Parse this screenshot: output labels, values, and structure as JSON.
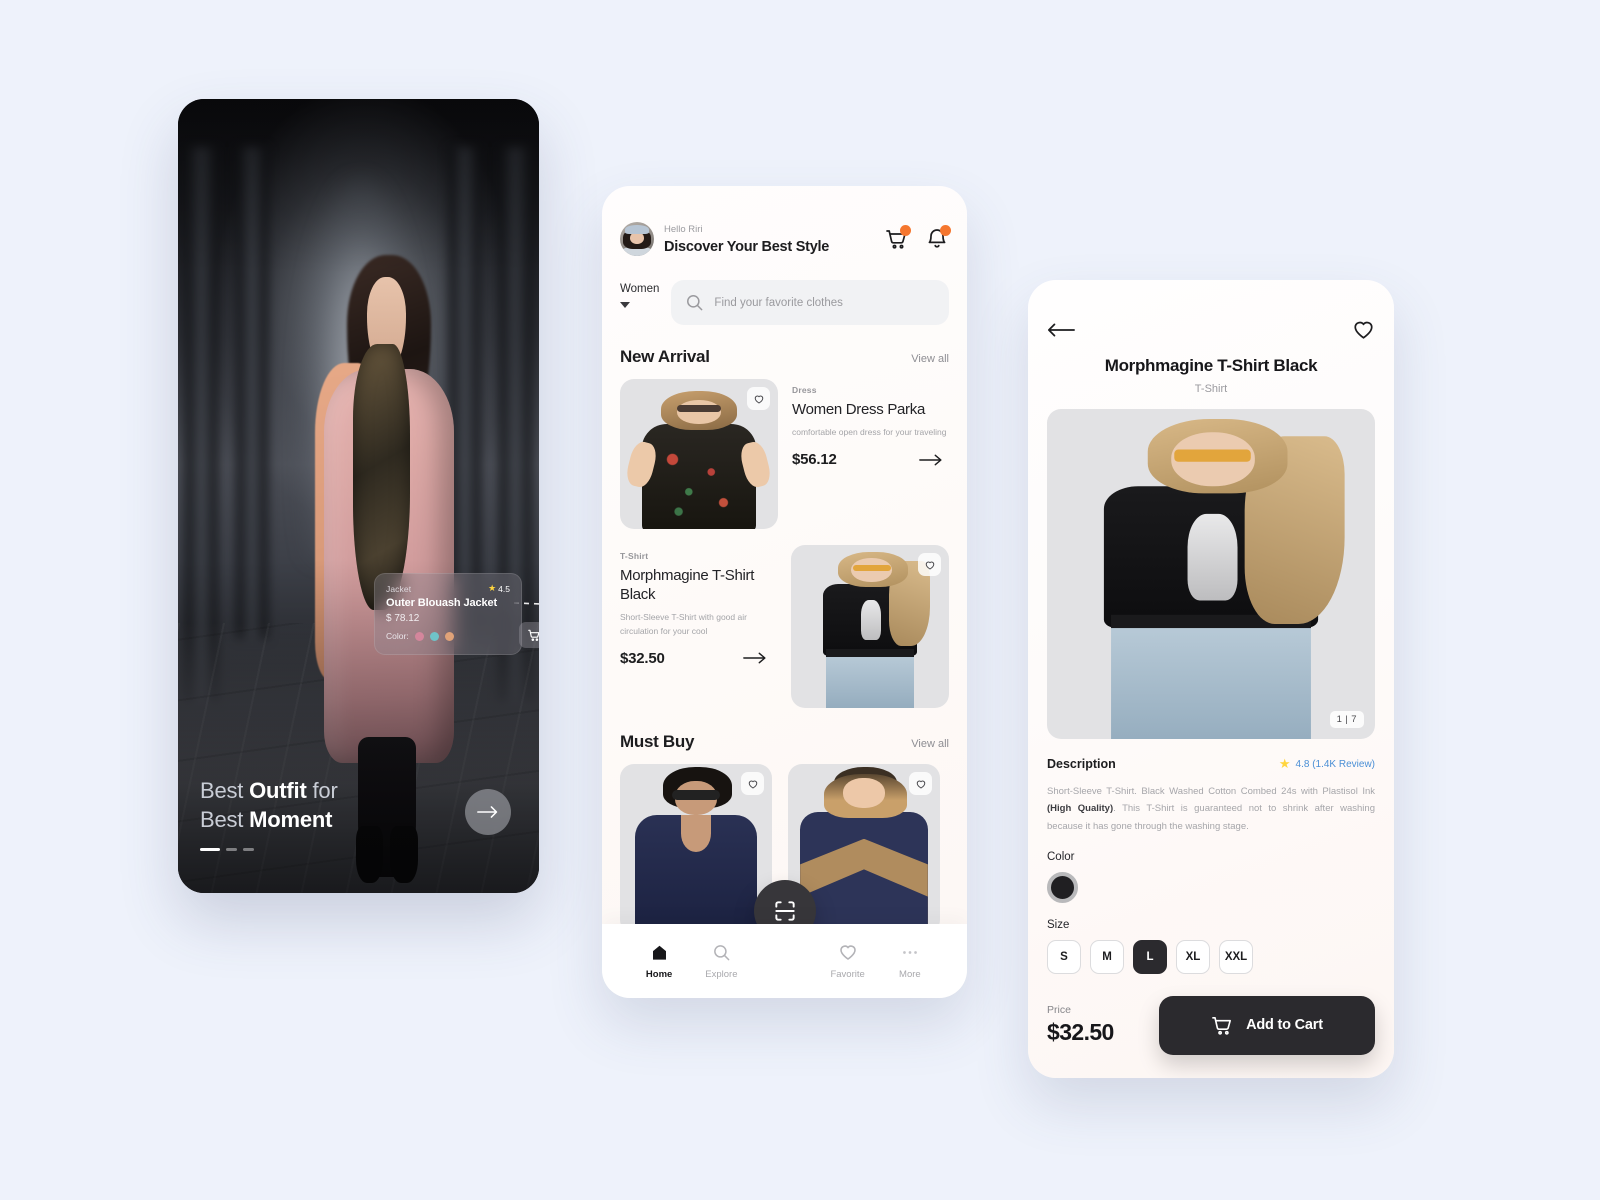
{
  "theme": {
    "page_bg": "#eef2fb",
    "accent_orange": "#f5762e",
    "dark": "#2b2a2e",
    "review_blue": "#4b8fd6",
    "star_yellow": "#ffd53e"
  },
  "phone1": {
    "tag_card": {
      "category": "Jacket",
      "rating": "4.5",
      "title": "Outer Blouash Jacket",
      "price": "$ 78.12",
      "color_label": "Color:",
      "swatches": [
        "#d4869c",
        "#6fc3c8",
        "#e0a278"
      ]
    },
    "headline_line1_plain": "Best ",
    "headline_line1_bold": "Outfit",
    "headline_line1_tail": " for",
    "headline_line2_plain": "Best ",
    "headline_line2_bold": "Moment",
    "next_icon": "arrow-right-icon"
  },
  "phone2": {
    "header": {
      "greeting": "Hello Riri",
      "title": "Discover Your Best Style",
      "cart_icon": "cart-icon",
      "bell_icon": "bell-icon"
    },
    "category_filter": {
      "label": "Women"
    },
    "search": {
      "placeholder": "Find your favorite clothes",
      "icon": "search-icon"
    },
    "sections": [
      {
        "title": "New Arrival",
        "view_all": "View all",
        "items": [
          {
            "category": "Dress",
            "name": "Women Dress Parka",
            "description": "comfortable open dress for your traveling",
            "price": "$56.12"
          },
          {
            "category": "T-Shirt",
            "name": "Morphmagine T-Shirt Black",
            "description": "Short-Sleeve T-Shirt with good air circulation for your cool",
            "price": "$32.50"
          }
        ]
      },
      {
        "title": "Must Buy",
        "view_all": "View all",
        "items": []
      }
    ],
    "scan_icon": "scan-icon",
    "nav": [
      {
        "label": "Home",
        "icon": "home-icon",
        "active": true
      },
      {
        "label": "Explore",
        "icon": "search-icon",
        "active": false
      },
      {
        "label": "Favorite",
        "icon": "heart-icon",
        "active": false
      },
      {
        "label": "More",
        "icon": "ellipsis-icon",
        "active": false
      }
    ]
  },
  "phone3": {
    "back_icon": "arrow-left-icon",
    "favorite_icon": "heart-icon",
    "title": "Morphmagine T-Shirt Black",
    "subtitle": "T-Shirt",
    "image_counter": "1 | 7",
    "description_label": "Description",
    "rating_value": "4.8 (1.4K Review)",
    "description_part1": "Short-Sleeve T-Shirt. Black Washed Cotton Combed 24s with Plastisol Ink ",
    "description_bold": "(High Quality)",
    "description_part2": ". This T-Shirt is guaranteed not to shrink after washing because it has gone through the washing stage.",
    "color_label": "Color",
    "color_value": "#201f22",
    "size_label": "Size",
    "sizes": [
      "S",
      "M",
      "L",
      "XL",
      "XXL"
    ],
    "selected_size": "L",
    "price_label": "Price",
    "price": "$32.50",
    "add_to_cart": "Add to Cart",
    "cart_icon": "cart-icon"
  }
}
